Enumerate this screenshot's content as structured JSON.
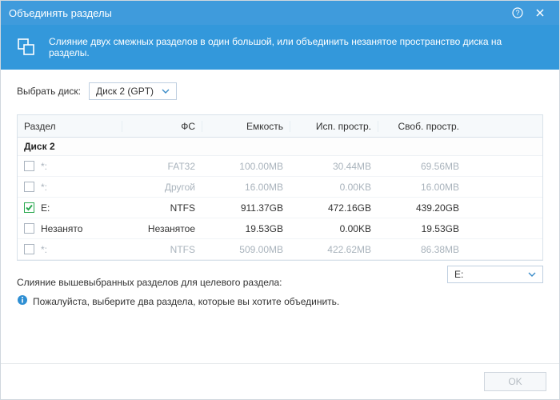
{
  "window": {
    "title": "Объединять разделы"
  },
  "banner": {
    "text": "Слияние двух смежных разделов в один большой, или объединить незанятое пространство диска на разделы."
  },
  "disk_select": {
    "label": "Выбрать диск:",
    "value": "Диск 2 (GPT)"
  },
  "table": {
    "headers": {
      "partition": "Раздел",
      "fs": "ФС",
      "capacity": "Емкость",
      "used": "Исп. простр.",
      "free": "Своб. простр."
    },
    "group": "Диск 2",
    "rows": [
      {
        "checked": false,
        "dim": true,
        "partition": "*:",
        "fs": "FAT32",
        "capacity": "100.00MB",
        "used": "30.44MB",
        "free": "69.56MB"
      },
      {
        "checked": false,
        "dim": true,
        "partition": "*:",
        "fs": "Другой",
        "capacity": "16.00MB",
        "used": "0.00KB",
        "free": "16.00MB"
      },
      {
        "checked": true,
        "dim": false,
        "partition": "E:",
        "fs": "NTFS",
        "capacity": "911.37GB",
        "used": "472.16GB",
        "free": "439.20GB"
      },
      {
        "checked": false,
        "dim": false,
        "partition": "Незанято",
        "fs": "Незанятое",
        "capacity": "19.53GB",
        "used": "0.00KB",
        "free": "19.53GB"
      },
      {
        "checked": false,
        "dim": true,
        "partition": "*:",
        "fs": "NTFS",
        "capacity": "509.00MB",
        "used": "422.62MB",
        "free": "86.38MB"
      }
    ]
  },
  "merge": {
    "label": "Слияние вышевыбранных разделов для целевого раздела:",
    "target": "E:"
  },
  "info": {
    "text": "Пожалуйста, выберите два раздела, которые вы хотите объединить."
  },
  "footer": {
    "ok": "OK"
  },
  "colors": {
    "accent": "#3398db"
  }
}
